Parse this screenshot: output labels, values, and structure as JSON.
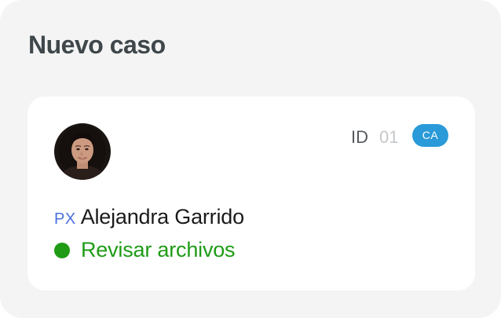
{
  "panel": {
    "title": "Nuevo caso"
  },
  "case": {
    "id_label": "ID",
    "id_value": "01",
    "badge": "CA",
    "role_tag": "PX",
    "name": "Alejandra Garrido",
    "status": "Revisar archivos"
  },
  "colors": {
    "panel_background": "#f4f4f4",
    "card_background": "#ffffff",
    "badge": "#2a9ad8",
    "role_tag": "#4a6fdc",
    "status": "#1f9b16"
  },
  "icons": {
    "status": "status-dot-icon",
    "avatar": "user-avatar-photo"
  }
}
